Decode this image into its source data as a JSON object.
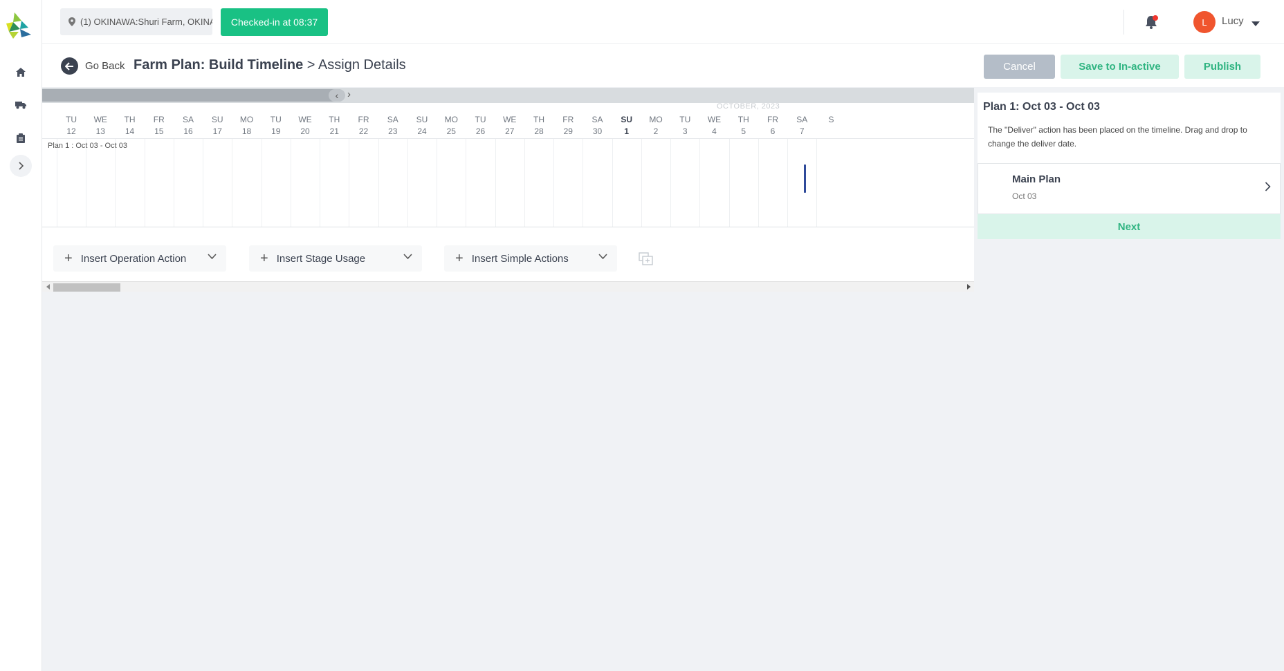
{
  "topbar": {
    "location": "(1) OKINAWA:Shuri Farm, OKINA",
    "checkin": "Checked-in at 08:37",
    "user": {
      "initial": "L",
      "name": "Lucy"
    }
  },
  "sidebar": {
    "items": [
      "home-icon",
      "truck-icon",
      "clipboard-icon",
      "expand-icon"
    ]
  },
  "page": {
    "goback": "Go Back",
    "title_bold": "Farm Plan: Build Timeline",
    "title_rest": " > Assign Details",
    "cancel": "Cancel",
    "save_inactive": "Save to In-active",
    "publish": "Publish"
  },
  "timeline": {
    "month": "OCTOBER, 2023",
    "days": [
      {
        "dow": "TU",
        "d": "12"
      },
      {
        "dow": "WE",
        "d": "13"
      },
      {
        "dow": "TH",
        "d": "14"
      },
      {
        "dow": "FR",
        "d": "15"
      },
      {
        "dow": "SA",
        "d": "16"
      },
      {
        "dow": "SU",
        "d": "17"
      },
      {
        "dow": "MO",
        "d": "18"
      },
      {
        "dow": "TU",
        "d": "19"
      },
      {
        "dow": "WE",
        "d": "20"
      },
      {
        "dow": "TH",
        "d": "21"
      },
      {
        "dow": "FR",
        "d": "22"
      },
      {
        "dow": "SA",
        "d": "23"
      },
      {
        "dow": "SU",
        "d": "24"
      },
      {
        "dow": "MO",
        "d": "25"
      },
      {
        "dow": "TU",
        "d": "26"
      },
      {
        "dow": "WE",
        "d": "27"
      },
      {
        "dow": "TH",
        "d": "28"
      },
      {
        "dow": "FR",
        "d": "29"
      },
      {
        "dow": "SA",
        "d": "30"
      },
      {
        "dow": "SU",
        "d": "1",
        "highlight": true
      },
      {
        "dow": "MO",
        "d": "2"
      },
      {
        "dow": "TU",
        "d": "3"
      },
      {
        "dow": "WE",
        "d": "4"
      },
      {
        "dow": "TH",
        "d": "5"
      },
      {
        "dow": "FR",
        "d": "6"
      },
      {
        "dow": "SA",
        "d": "7"
      },
      {
        "dow": "S",
        "d": ""
      }
    ],
    "plan_label": "Plan 1 : Oct 03 - Oct 03",
    "insert_operation": "Insert Operation Action",
    "insert_stage": "Insert Stage Usage",
    "insert_simple": "Insert Simple Actions"
  },
  "panel": {
    "title": "Plan 1: Oct 03 - Oct 03",
    "message": "The \"Deliver\" action has been placed on the timeline. Drag and drop to change the deliver date.",
    "item_name": "Main Plan",
    "item_date": "Oct 03",
    "next": "Next"
  },
  "colors": {
    "accent": "#19c184",
    "accent_soft": "#d9f4ea",
    "marker": "#2f4a9a",
    "avatar": "#f0552e"
  }
}
